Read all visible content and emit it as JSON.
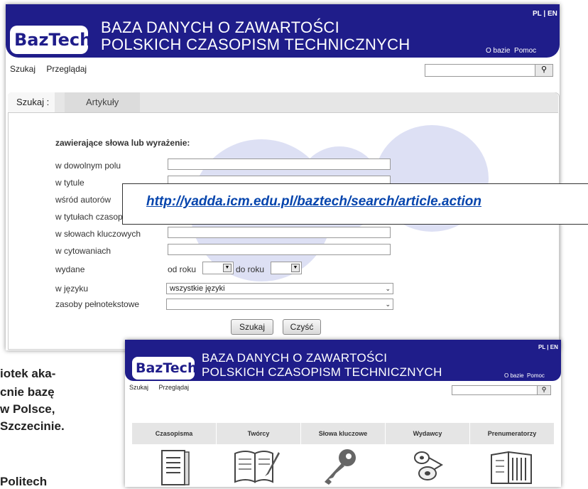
{
  "shot1": {
    "header": {
      "logo": "BazTech",
      "title_line1": "BAZA DANYCH O ZAWARTOŚCI",
      "title_line2": "POLSKICH CZASOPISM TECHNICZNYCH",
      "lang": "PL | EN",
      "about": "O bazie",
      "help": "Pomoc"
    },
    "nav": {
      "search": "Szukaj",
      "browse": "Przeglądaj"
    },
    "tabs": {
      "active": "Szukaj :",
      "articles": "Artykuły"
    },
    "form": {
      "heading": "zawierające słowa lub wyrażenie:",
      "any_field": "w dowolnym polu",
      "title": "w tytule",
      "authors": "wśród autorów",
      "journal_titles": "w tytułach czasopism",
      "keywords": "w słowach kluczowych",
      "citations": "w cytowaniach",
      "published": "wydane",
      "from_year": "od roku",
      "to_year": "do roku",
      "language": "w języku",
      "language_value": "wszystkie języki",
      "fulltext": "zasoby pełnotekstowe",
      "search_btn": "Szukaj",
      "clear_btn": "Czyść"
    }
  },
  "url": "http://yadda.icm.edu.pl/baztech/search/article.action",
  "bottom_text": {
    "line1": "iotek aka-",
    "line2": "cnie  bazę",
    "line3": "w Polsce,",
    "line4": "Szczecinie.",
    "line5": "Politech"
  },
  "shot2": {
    "header": {
      "logo": "BazTech",
      "title_line1": "BAZA DANYCH O ZAWARTOŚCI",
      "title_line2": "POLSKICH CZASOPISM TECHNICZNYCH",
      "lang": "PL | EN",
      "about": "O bazie",
      "help": "Pomoc"
    },
    "nav": {
      "search": "Szukaj",
      "browse": "Przeglądaj"
    },
    "categories": [
      "Czasopisma",
      "Twórcy",
      "Słowa kluczowe",
      "Wydawcy",
      "Prenumeratorzy"
    ]
  },
  "colors": {
    "header": "#1f1d8a",
    "link": "#0645ad",
    "watermark": "#dde0f4"
  }
}
